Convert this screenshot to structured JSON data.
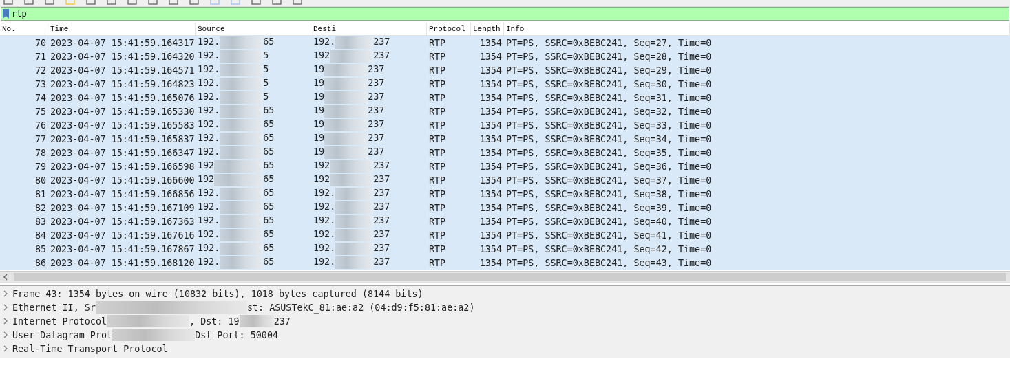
{
  "filter": {
    "value": "rtp"
  },
  "packet_list": {
    "columns": [
      "No.",
      "Time",
      "Source",
      "Desti",
      "Protocol",
      "Length",
      "Info"
    ],
    "rows": [
      {
        "no": "70",
        "time": "2023-04-07 15:41:59.164317",
        "source": [
          "192.",
          "65"
        ],
        "destination": [
          "192.",
          "237"
        ],
        "protocol": "RTP",
        "length": "1354",
        "info": "PT=PS, SSRC=0xBEBC241, Seq=27, Time=0"
      },
      {
        "no": "71",
        "time": "2023-04-07 15:41:59.164320",
        "source": [
          "192.",
          "5"
        ],
        "destination": [
          "192",
          "237"
        ],
        "protocol": "RTP",
        "length": "1354",
        "info": "PT=PS, SSRC=0xBEBC241, Seq=28, Time=0"
      },
      {
        "no": "72",
        "time": "2023-04-07 15:41:59.164571",
        "source": [
          "192.",
          "5"
        ],
        "destination": [
          "19",
          "237"
        ],
        "protocol": "RTP",
        "length": "1354",
        "info": "PT=PS, SSRC=0xBEBC241, Seq=29, Time=0"
      },
      {
        "no": "73",
        "time": "2023-04-07 15:41:59.164823",
        "source": [
          "192.",
          "5"
        ],
        "destination": [
          "19",
          "237"
        ],
        "protocol": "RTP",
        "length": "1354",
        "info": "PT=PS, SSRC=0xBEBC241, Seq=30, Time=0"
      },
      {
        "no": "74",
        "time": "2023-04-07 15:41:59.165076",
        "source": [
          "192.",
          "5"
        ],
        "destination": [
          "19",
          "237"
        ],
        "protocol": "RTP",
        "length": "1354",
        "info": "PT=PS, SSRC=0xBEBC241, Seq=31, Time=0"
      },
      {
        "no": "75",
        "time": "2023-04-07 15:41:59.165330",
        "source": [
          "192.",
          "65"
        ],
        "destination": [
          "19",
          "237"
        ],
        "protocol": "RTP",
        "length": "1354",
        "info": "PT=PS, SSRC=0xBEBC241, Seq=32, Time=0"
      },
      {
        "no": "76",
        "time": "2023-04-07 15:41:59.165583",
        "source": [
          "192.",
          "65"
        ],
        "destination": [
          "19",
          "237"
        ],
        "protocol": "RTP",
        "length": "1354",
        "info": "PT=PS, SSRC=0xBEBC241, Seq=33, Time=0"
      },
      {
        "no": "77",
        "time": "2023-04-07 15:41:59.165837",
        "source": [
          "192.",
          "65"
        ],
        "destination": [
          "19",
          "237"
        ],
        "protocol": "RTP",
        "length": "1354",
        "info": "PT=PS, SSRC=0xBEBC241, Seq=34, Time=0"
      },
      {
        "no": "78",
        "time": "2023-04-07 15:41:59.166347",
        "source": [
          "192.",
          "65"
        ],
        "destination": [
          "19",
          "237"
        ],
        "protocol": "RTP",
        "length": "1354",
        "info": "PT=PS, SSRC=0xBEBC241, Seq=35, Time=0"
      },
      {
        "no": "79",
        "time": "2023-04-07 15:41:59.166598",
        "source": [
          "192",
          "65"
        ],
        "destination": [
          "192",
          "237"
        ],
        "protocol": "RTP",
        "length": "1354",
        "info": "PT=PS, SSRC=0xBEBC241, Seq=36, Time=0"
      },
      {
        "no": "80",
        "time": "2023-04-07 15:41:59.166600",
        "source": [
          "192",
          "65"
        ],
        "destination": [
          "192",
          "237"
        ],
        "protocol": "RTP",
        "length": "1354",
        "info": "PT=PS, SSRC=0xBEBC241, Seq=37, Time=0"
      },
      {
        "no": "81",
        "time": "2023-04-07 15:41:59.166856",
        "source": [
          "192.",
          "65"
        ],
        "destination": [
          "192.",
          "237"
        ],
        "protocol": "RTP",
        "length": "1354",
        "info": "PT=PS, SSRC=0xBEBC241, Seq=38, Time=0"
      },
      {
        "no": "82",
        "time": "2023-04-07 15:41:59.167109",
        "source": [
          "192.",
          "65"
        ],
        "destination": [
          "192.",
          "237"
        ],
        "protocol": "RTP",
        "length": "1354",
        "info": "PT=PS, SSRC=0xBEBC241, Seq=39, Time=0"
      },
      {
        "no": "83",
        "time": "2023-04-07 15:41:59.167363",
        "source": [
          "192.",
          "65"
        ],
        "destination": [
          "192.",
          "237"
        ],
        "protocol": "RTP",
        "length": "1354",
        "info": "PT=PS, SSRC=0xBEBC241, Seq=40, Time=0"
      },
      {
        "no": "84",
        "time": "2023-04-07 15:41:59.167616",
        "source": [
          "192.",
          "65"
        ],
        "destination": [
          "192.",
          "237"
        ],
        "protocol": "RTP",
        "length": "1354",
        "info": "PT=PS, SSRC=0xBEBC241, Seq=41, Time=0"
      },
      {
        "no": "85",
        "time": "2023-04-07 15:41:59.167867",
        "source": [
          "192.",
          "65"
        ],
        "destination": [
          "192.",
          "237"
        ],
        "protocol": "RTP",
        "length": "1354",
        "info": "PT=PS, SSRC=0xBEBC241, Seq=42, Time=0"
      },
      {
        "no": "86",
        "time": "2023-04-07 15:41:59.168120",
        "source": [
          "192.",
          "65"
        ],
        "destination": [
          "192.",
          "237"
        ],
        "protocol": "RTP",
        "length": "1354",
        "info": "PT=PS, SSRC=0xBEBC241, Seq=43, Time=0"
      }
    ]
  },
  "details": [
    {
      "segments": [
        "Frame 43: 1354 bytes on wire (10832 bits), 1018 bytes captured (8144 bits)"
      ],
      "expanded": false
    },
    {
      "segments": [
        "Ethernet II, Sr",
        "st: ASUSTekC_81:ae:a2 (04:d9:f5:81:ae:a2)"
      ],
      "expanded": false
    },
    {
      "segments": [
        "Internet Protocol",
        ", Dst: 19",
        "237"
      ],
      "expanded": false
    },
    {
      "segments": [
        "User Datagram Prot",
        "Dst Port: 50004"
      ],
      "expanded": false
    },
    {
      "segments": [
        "Real-Time Transport Protocol"
      ],
      "expanded": false
    }
  ]
}
